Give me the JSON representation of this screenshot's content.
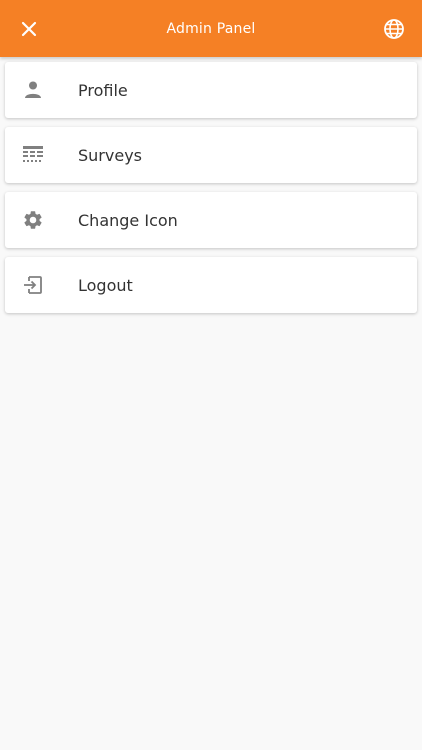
{
  "appbar": {
    "title": "Admin Panel",
    "left_icon": "close-icon",
    "right_icon": "globe-icon",
    "background": "#f58025"
  },
  "menu": {
    "items": [
      {
        "label": "Profile",
        "icon": "person-icon"
      },
      {
        "label": "Surveys",
        "icon": "survey-list-icon"
      },
      {
        "label": "Change Icon",
        "icon": "gear-icon"
      },
      {
        "label": "Logout",
        "icon": "logout-icon"
      }
    ]
  },
  "colors": {
    "accent": "#f58025",
    "icon": "#808080",
    "text": "#333333",
    "background": "#f9f9f9"
  }
}
